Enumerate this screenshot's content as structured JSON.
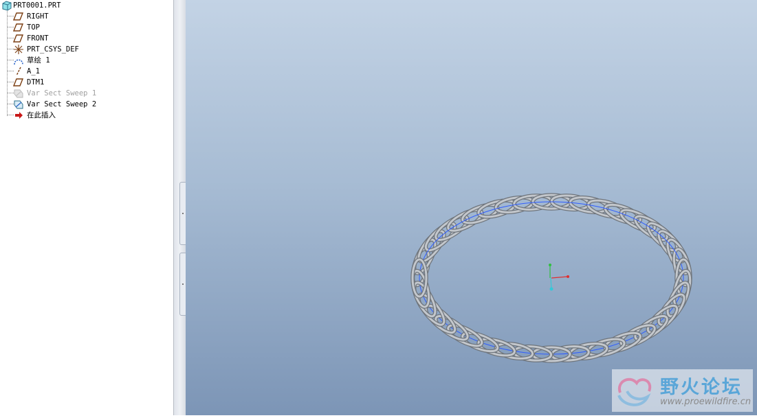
{
  "model_tree": {
    "root": {
      "label": "PRT0001.PRT",
      "icon": "part-icon"
    },
    "items": [
      {
        "label": "RIGHT",
        "icon": "datum-plane-icon"
      },
      {
        "label": "TOP",
        "icon": "datum-plane-icon"
      },
      {
        "label": "FRONT",
        "icon": "datum-plane-icon"
      },
      {
        "label": "PRT_CSYS_DEF",
        "icon": "coordinate-system-icon"
      },
      {
        "label": "草绘 1",
        "icon": "sketch-icon"
      },
      {
        "label": "A_1",
        "icon": "datum-axis-icon"
      },
      {
        "label": "DTM1",
        "icon": "datum-plane-icon"
      },
      {
        "label": "Var Sect Sweep 1",
        "icon": "sweep-feature-icon",
        "suppressed": true
      },
      {
        "label": "Var Sect Sweep 2",
        "icon": "sweep-feature-icon"
      },
      {
        "label": "在此插入",
        "icon": "insert-here-arrow-icon"
      }
    ]
  },
  "viewport": {
    "model": "helical-coil-ring",
    "colors": {
      "coil": "#a9adb2",
      "trajectory": "#2f5cff",
      "axis_x": "#e03030",
      "axis_y": "#2fbf3f",
      "axis_z": "#35c8d8"
    }
  },
  "watermark": {
    "title": "野火论坛",
    "url": "www.proewildfire.cn"
  }
}
